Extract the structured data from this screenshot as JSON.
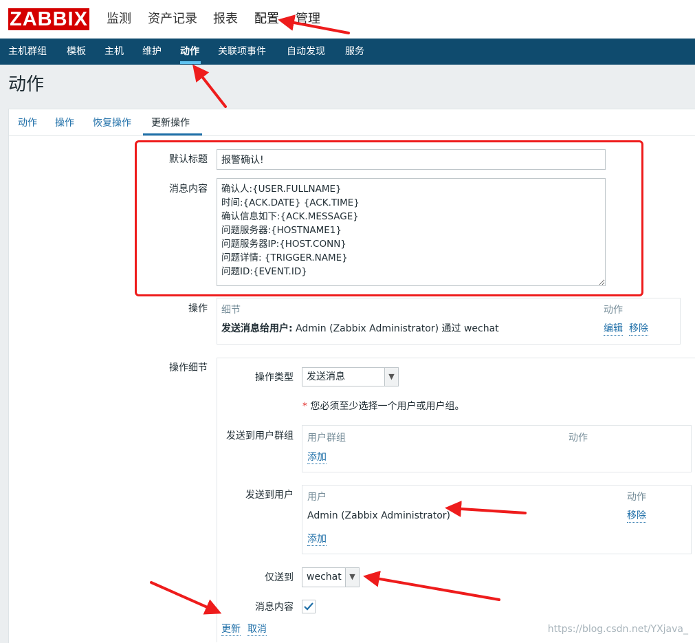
{
  "brand": {
    "logo": "ZABBIX",
    "accent": "#d40000",
    "nav_bg": "#0f4b6e",
    "link": "#1f6fa8"
  },
  "top_menu": [
    "监测",
    "资产记录",
    "报表",
    "配置",
    "管理"
  ],
  "sub_menu": [
    "主机群组",
    "模板",
    "主机",
    "维护",
    "动作",
    "关联项事件",
    "自动发现",
    "服务"
  ],
  "page_title": "动作",
  "tabs": [
    "动作",
    "操作",
    "恢复操作",
    "更新操作"
  ],
  "form": {
    "default_subject_label": "默认标题",
    "default_subject_value": "报警确认!",
    "message_label": "消息内容",
    "message_value": "确认人:{USER.FULLNAME}\n时间:{ACK.DATE} {ACK.TIME}\n确认信息如下:{ACK.MESSAGE}\n问题服务器:{HOSTNAME1}\n问题服务器IP:{HOST.CONN}\n问题详情: {TRIGGER.NAME}\n问题ID:{EVENT.ID}",
    "operations_label": "操作",
    "operations_table": {
      "col_details": "细节",
      "col_action": "动作",
      "row_bold": "发送消息给用户:",
      "row_rest": " Admin (Zabbix Administrator) 通过 wechat",
      "edit": "编辑",
      "remove": "移除"
    },
    "op_details_label": "操作细节",
    "op_type_label": "操作类型",
    "op_type_value": "发送消息",
    "required_star": "*",
    "required_note": "您必须至少选择一个用户或用户组。",
    "send_to_groups_label": "发送到用户群组",
    "groups_table": {
      "col_group": "用户群组",
      "col_action": "动作",
      "add": "添加"
    },
    "send_to_users_label": "发送到用户",
    "users_table": {
      "col_user": "用户",
      "col_action": "动作",
      "user": "Admin (Zabbix Administrator)",
      "remove": "移除",
      "add": "添加"
    },
    "send_only_to_label": "仅送到",
    "send_only_to_value": "wechat",
    "default_message_label": "消息内容",
    "update": "更新",
    "cancel": "取消"
  },
  "watermark": "https://blog.csdn.net/YXjava_"
}
